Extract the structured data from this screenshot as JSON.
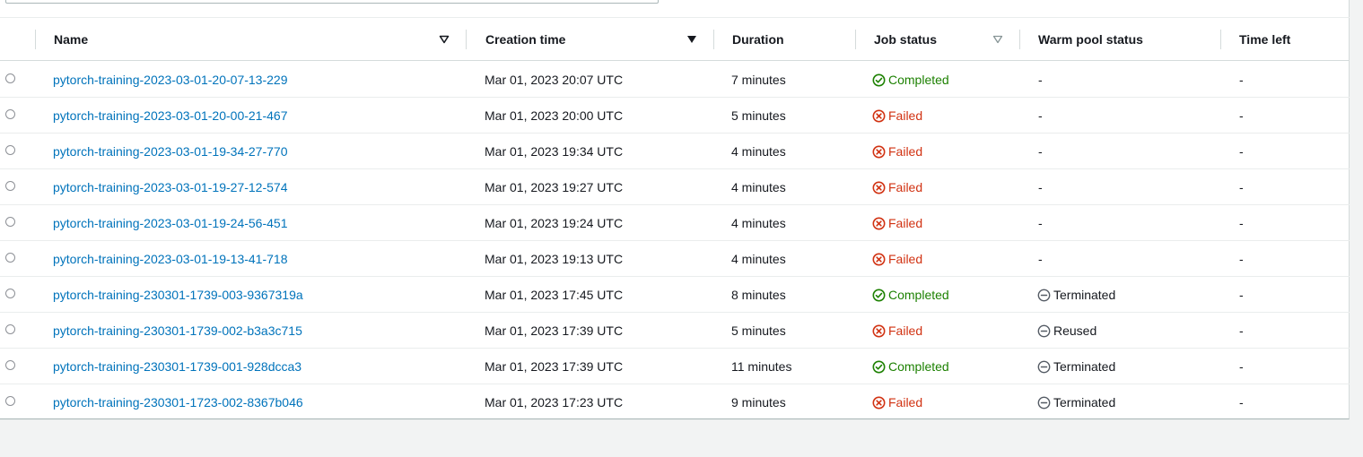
{
  "colors": {
    "completed": "#1d8102",
    "failed": "#d13212",
    "link": "#0073bb",
    "neutral": "#545b64"
  },
  "table": {
    "columns": {
      "name": "Name",
      "creation_time": "Creation time",
      "duration": "Duration",
      "job_status": "Job status",
      "warm_pool_status": "Warm pool status",
      "time_left": "Time left"
    },
    "rows": [
      {
        "name": "pytorch-training-2023-03-01-20-07-13-229",
        "creation_time": "Mar 01, 2023 20:07 UTC",
        "duration": "7 minutes",
        "job_status": "Completed",
        "warm_pool_status": "-",
        "time_left": "-"
      },
      {
        "name": "pytorch-training-2023-03-01-20-00-21-467",
        "creation_time": "Mar 01, 2023 20:00 UTC",
        "duration": "5 minutes",
        "job_status": "Failed",
        "warm_pool_status": "-",
        "time_left": "-"
      },
      {
        "name": "pytorch-training-2023-03-01-19-34-27-770",
        "creation_time": "Mar 01, 2023 19:34 UTC",
        "duration": "4 minutes",
        "job_status": "Failed",
        "warm_pool_status": "-",
        "time_left": "-"
      },
      {
        "name": "pytorch-training-2023-03-01-19-27-12-574",
        "creation_time": "Mar 01, 2023 19:27 UTC",
        "duration": "4 minutes",
        "job_status": "Failed",
        "warm_pool_status": "-",
        "time_left": "-"
      },
      {
        "name": "pytorch-training-2023-03-01-19-24-56-451",
        "creation_time": "Mar 01, 2023 19:24 UTC",
        "duration": "4 minutes",
        "job_status": "Failed",
        "warm_pool_status": "-",
        "time_left": "-"
      },
      {
        "name": "pytorch-training-2023-03-01-19-13-41-718",
        "creation_time": "Mar 01, 2023 19:13 UTC",
        "duration": "4 minutes",
        "job_status": "Failed",
        "warm_pool_status": "-",
        "time_left": "-"
      },
      {
        "name": "pytorch-training-230301-1739-003-9367319a",
        "creation_time": "Mar 01, 2023 17:45 UTC",
        "duration": "8 minutes",
        "job_status": "Completed",
        "warm_pool_status": "Terminated",
        "time_left": "-"
      },
      {
        "name": "pytorch-training-230301-1739-002-b3a3c715",
        "creation_time": "Mar 01, 2023 17:39 UTC",
        "duration": "5 minutes",
        "job_status": "Failed",
        "warm_pool_status": "Reused",
        "time_left": "-"
      },
      {
        "name": "pytorch-training-230301-1739-001-928dcca3",
        "creation_time": "Mar 01, 2023 17:39 UTC",
        "duration": "11 minutes",
        "job_status": "Completed",
        "warm_pool_status": "Terminated",
        "time_left": "-"
      },
      {
        "name": "pytorch-training-230301-1723-002-8367b046",
        "creation_time": "Mar 01, 2023 17:23 UTC",
        "duration": "9 minutes",
        "job_status": "Failed",
        "warm_pool_status": "Terminated",
        "time_left": "-"
      }
    ]
  }
}
